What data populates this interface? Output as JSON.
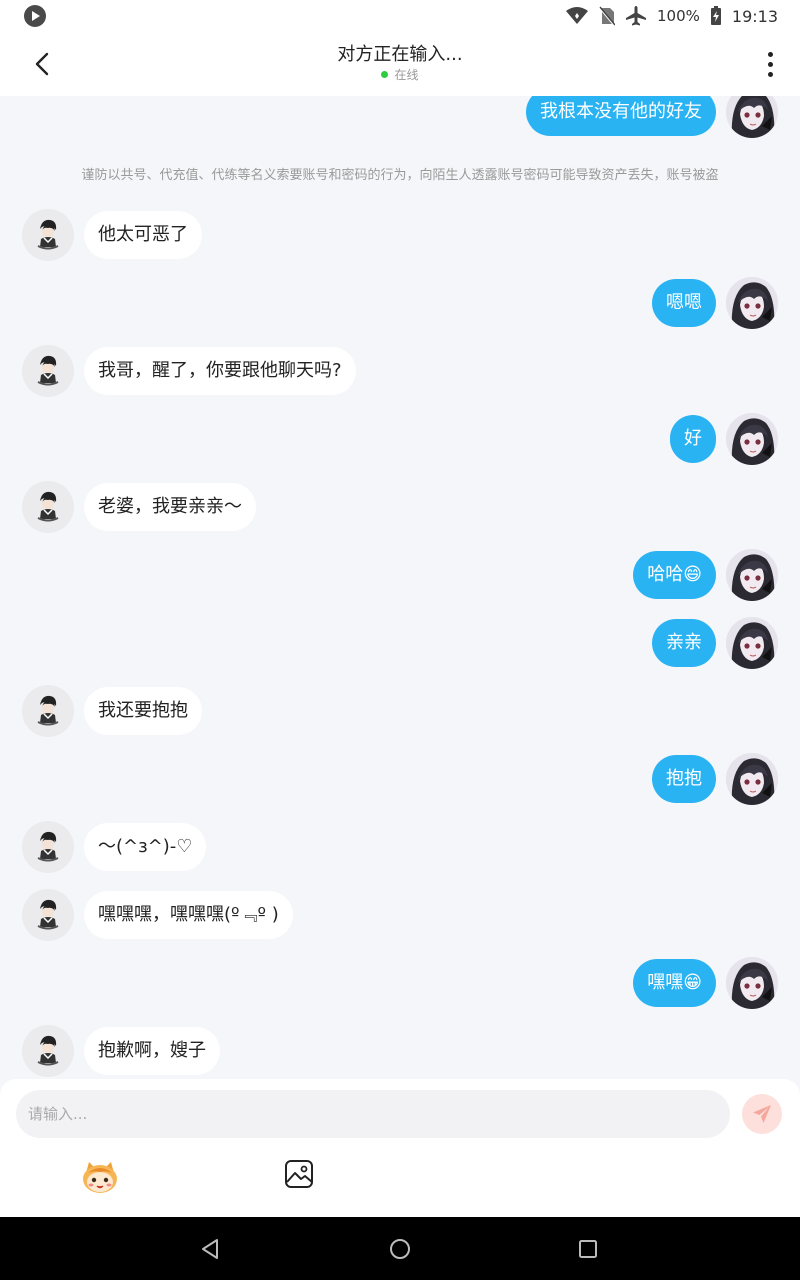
{
  "status_bar": {
    "battery": "100%",
    "time": "19:13"
  },
  "header": {
    "title": "对方正在输入...",
    "status": "在线"
  },
  "notice": "谨防以共号、代充值、代练等名义索要账号和密码的行为，向陌生人透露账号密码可能导致资产丢失，账号被盗",
  "messages": [
    {
      "side": "right",
      "text": "我根本没有他的好友"
    },
    {
      "side": "left",
      "text": "他太可恶了"
    },
    {
      "side": "right",
      "text": "嗯嗯"
    },
    {
      "side": "left",
      "text": "我哥，醒了，你要跟他聊天吗?"
    },
    {
      "side": "right",
      "text": "好"
    },
    {
      "side": "left",
      "text": "老婆，我要亲亲～"
    },
    {
      "side": "right",
      "text": "哈哈😄"
    },
    {
      "side": "right",
      "text": "亲亲"
    },
    {
      "side": "left",
      "text": "我还要抱抱"
    },
    {
      "side": "right",
      "text": "抱抱"
    },
    {
      "side": "left",
      "text": "～(^з^)-♡"
    },
    {
      "side": "left",
      "text": "嘿嘿嘿，嘿嘿嘿(º﹃º )"
    },
    {
      "side": "right",
      "text": "嘿嘿😁"
    },
    {
      "side": "left",
      "text": "抱歉啊，嫂子"
    }
  ],
  "input": {
    "placeholder": "请输入...",
    "value": ""
  },
  "icons": {
    "back": "back-arrow-icon",
    "more": "more-vertical-icon",
    "send": "send-icon",
    "emoji": "emoji-icon",
    "image": "image-icon",
    "nav_back": "nav-back-icon",
    "nav_home": "nav-home-icon",
    "nav_recents": "nav-recents-icon"
  },
  "colors": {
    "accent": "#2ab3f3",
    "online_dot": "#2ecc40",
    "send_button": "#fde0dc"
  }
}
